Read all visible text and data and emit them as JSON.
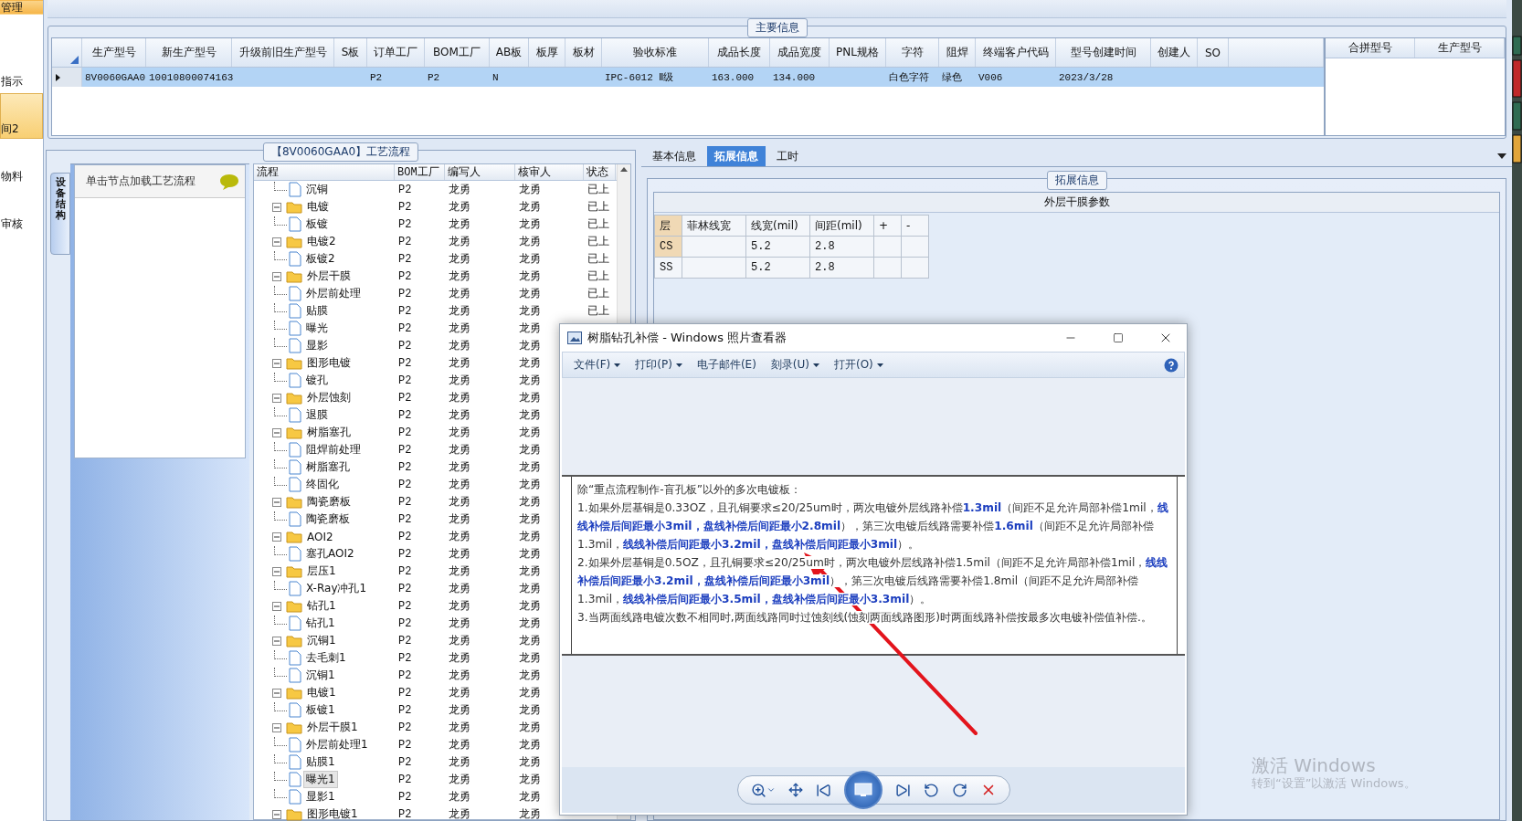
{
  "sidebar": {
    "items": [
      {
        "label": "管理",
        "kind": "header",
        "selected": false
      },
      {
        "label": "指示",
        "kind": "item",
        "selected": false
      },
      {
        "label": "间2",
        "kind": "item",
        "selected": true
      },
      {
        "label": "物料",
        "kind": "item",
        "selected": false
      },
      {
        "label": "审核",
        "kind": "item",
        "selected": false
      }
    ]
  },
  "main_info": {
    "title": "主要信息",
    "columns": [
      "生产型号",
      "新生产型号",
      "升级前旧生产型号",
      "S板",
      "订单工厂",
      "BOM工厂",
      "AB板",
      "板厚",
      "板材",
      "验收标准",
      "成品长度",
      "成品宽度",
      "PNL规格",
      "字符",
      "阻焊",
      "终端客户代码",
      "型号创建时间",
      "创建人",
      "SO"
    ],
    "rows": [
      {
        "selected": true,
        "cells": [
          "8V0060GAA0",
          "10010800074163",
          null,
          null,
          "P2",
          "P2",
          "N",
          null,
          null,
          "IPC-6012 Ⅱ级",
          "163.000",
          "134.000",
          null,
          "白色字符",
          "绿色",
          "V006",
          "2023/3/28",
          null,
          null
        ]
      }
    ],
    "side_columns": [
      "合拼型号",
      "生产型号"
    ]
  },
  "process": {
    "title": "【8V0060GAA0】工艺流程",
    "side_tab": "设备结构",
    "hint": "单击节点加载工艺流程",
    "columns": [
      "流程",
      "BOM工厂",
      "编写人",
      "核审人",
      "状态"
    ],
    "nodes": [
      {
        "children": [
          {
            "label": "沉铜",
            "bom": "P2",
            "author": "龙勇",
            "reviewer": "龙勇",
            "status": "已上",
            "selected": false
          }
        ]
      },
      {
        "label": "电镀",
        "bom": "P2",
        "author": "龙勇",
        "reviewer": "龙勇",
        "status": "已上",
        "selected": false,
        "expanded": true,
        "children": [
          {
            "label": "板镀",
            "bom": "P2",
            "author": "龙勇",
            "reviewer": "龙勇",
            "status": "已上",
            "selected": false
          }
        ]
      },
      {
        "label": "电镀2",
        "bom": "P2",
        "author": "龙勇",
        "reviewer": "龙勇",
        "status": "已上",
        "selected": false,
        "expanded": true,
        "children": [
          {
            "label": "板镀2",
            "bom": "P2",
            "author": "龙勇",
            "reviewer": "龙勇",
            "status": "已上",
            "selected": false
          }
        ]
      },
      {
        "label": "外层干膜",
        "bom": "P2",
        "author": "龙勇",
        "reviewer": "龙勇",
        "status": "已上",
        "selected": false,
        "expanded": true,
        "children": [
          {
            "label": "外层前处理",
            "bom": "P2",
            "author": "龙勇",
            "reviewer": "龙勇",
            "status": "已上",
            "selected": false
          },
          {
            "label": "贴膜",
            "bom": "P2",
            "author": "龙勇",
            "reviewer": "龙勇",
            "status": "已上",
            "selected": false
          },
          {
            "label": "曝光",
            "bom": "P2",
            "author": "龙勇",
            "reviewer": "龙勇",
            "selected": false
          },
          {
            "label": "显影",
            "bom": "P2",
            "author": "龙勇",
            "reviewer": "龙勇",
            "selected": false
          }
        ]
      },
      {
        "label": "图形电镀",
        "bom": "P2",
        "author": "龙勇",
        "reviewer": "龙勇",
        "selected": false,
        "expanded": true,
        "children": [
          {
            "label": "镀孔",
            "bom": "P2",
            "author": "龙勇",
            "reviewer": "龙勇",
            "selected": false
          }
        ]
      },
      {
        "label": "外层蚀刻",
        "bom": "P2",
        "author": "龙勇",
        "reviewer": "龙勇",
        "selected": false,
        "expanded": true,
        "children": [
          {
            "label": "退膜",
            "bom": "P2",
            "author": "龙勇",
            "reviewer": "龙勇",
            "selected": false
          }
        ]
      },
      {
        "label": "树脂塞孔",
        "bom": "P2",
        "author": "龙勇",
        "reviewer": "龙勇",
        "selected": false,
        "expanded": true,
        "children": [
          {
            "label": "阻焊前处理",
            "bom": "P2",
            "author": "龙勇",
            "reviewer": "龙勇",
            "selected": false
          },
          {
            "label": "树脂塞孔",
            "bom": "P2",
            "author": "龙勇",
            "reviewer": "龙勇",
            "selected": false
          },
          {
            "label": "终固化",
            "bom": "P2",
            "author": "龙勇",
            "reviewer": "龙勇",
            "selected": false
          }
        ]
      },
      {
        "label": "陶瓷磨板",
        "bom": "P2",
        "author": "龙勇",
        "reviewer": "龙勇",
        "selected": false,
        "expanded": true,
        "children": [
          {
            "label": "陶瓷磨板",
            "bom": "P2",
            "author": "龙勇",
            "reviewer": "龙勇",
            "selected": false
          }
        ]
      },
      {
        "label": "AOI2",
        "bom": "P2",
        "author": "龙勇",
        "reviewer": "龙勇",
        "selected": false,
        "expanded": true,
        "children": [
          {
            "label": "塞孔AOI2",
            "bom": "P2",
            "author": "龙勇",
            "reviewer": "龙勇",
            "selected": false
          }
        ]
      },
      {
        "label": "层压1",
        "bom": "P2",
        "author": "龙勇",
        "reviewer": "龙勇",
        "selected": false,
        "expanded": true,
        "children": [
          {
            "label": "X-Ray冲孔1",
            "bom": "P2",
            "author": "龙勇",
            "reviewer": "龙勇",
            "selected": false
          }
        ]
      },
      {
        "label": "钻孔1",
        "bom": "P2",
        "author": "龙勇",
        "reviewer": "龙勇",
        "selected": false,
        "expanded": true,
        "children": [
          {
            "label": "钻孔1",
            "bom": "P2",
            "author": "龙勇",
            "reviewer": "龙勇",
            "selected": false
          }
        ]
      },
      {
        "label": "沉铜1",
        "bom": "P2",
        "author": "龙勇",
        "reviewer": "龙勇",
        "selected": false,
        "expanded": true,
        "children": [
          {
            "label": "去毛刺1",
            "bom": "P2",
            "author": "龙勇",
            "reviewer": "龙勇",
            "selected": false
          },
          {
            "label": "沉铜1",
            "bom": "P2",
            "author": "龙勇",
            "reviewer": "龙勇",
            "selected": false
          }
        ]
      },
      {
        "label": "电镀1",
        "bom": "P2",
        "author": "龙勇",
        "reviewer": "龙勇",
        "selected": false,
        "expanded": true,
        "children": [
          {
            "label": "板镀1",
            "bom": "P2",
            "author": "龙勇",
            "reviewer": "龙勇",
            "selected": false
          }
        ]
      },
      {
        "label": "外层干膜1",
        "bom": "P2",
        "author": "龙勇",
        "reviewer": "龙勇",
        "selected": false,
        "expanded": true,
        "children": [
          {
            "label": "外层前处理1",
            "bom": "P2",
            "author": "龙勇",
            "reviewer": "龙勇",
            "selected": false
          },
          {
            "label": "贴膜1",
            "bom": "P2",
            "author": "龙勇",
            "reviewer": "龙勇",
            "selected": false
          },
          {
            "label": "曝光1",
            "bom": "P2",
            "author": "龙勇",
            "reviewer": "龙勇",
            "selected": true
          },
          {
            "label": "显影1",
            "bom": "P2",
            "author": "龙勇",
            "reviewer": "龙勇",
            "selected": false
          }
        ]
      },
      {
        "label": "图形电镀1",
        "bom": "P2",
        "author": "龙勇",
        "reviewer": "龙勇",
        "selected": false,
        "expanded": true
      }
    ]
  },
  "details": {
    "tabs": [
      {
        "label": "基本信息",
        "selected": false
      },
      {
        "label": "拓展信息",
        "selected": true
      },
      {
        "label": "工时",
        "selected": false
      }
    ],
    "group_title": "拓展信息",
    "section_title": "外层干膜参数",
    "columns": [
      "层",
      "菲林线宽",
      "线宽(mil)",
      "间距(mil)",
      "+",
      "-"
    ],
    "rows": [
      {
        "selected": true,
        "cells": [
          "CS",
          null,
          "5.2",
          "2.8",
          null,
          null
        ]
      },
      {
        "selected": false,
        "cells": [
          "SS",
          null,
          "5.2",
          "2.8",
          null,
          null
        ]
      }
    ]
  },
  "photo_viewer": {
    "title": "树脂钻孔补偿 - Windows 照片查看器",
    "menu": [
      {
        "label": "文件(F)",
        "dropdown": true
      },
      {
        "label": "打印(P)",
        "dropdown": true
      },
      {
        "label": "电子邮件(E)",
        "dropdown": false
      },
      {
        "label": "刻录(U)",
        "dropdown": true
      },
      {
        "label": "打开(O)",
        "dropdown": true
      }
    ],
    "document": [
      "除“重点流程制作-盲孔板”以外的多次电镀板：",
      "1.如果外层基铜是0.33OZ，且孔铜要求≤20/25um时，两次电镀外层线路补偿**1.3mil**（间距不足允许局部补偿1mil，**线线补偿后间距最小3mil，盘线补偿后间距最小2.8mil**），第三次电镀后线路需要补偿**1.6mil**（间距不足允许局部补偿1.3mil，**线线补偿后间距最小3.2mil，盘线补偿后间距最小3mil**）。",
      "2.如果外层基铜是0.5OZ，且孔铜要求≤20/25um时，两次电镀外层线路补偿1.5mil（间距不足允许局部补偿1mil，**线线补偿后间距最小3.2mil，盘线补偿后间距最小3mil**），第三次电镀后线路需要补偿1.8mil（间距不足允许局部补偿1.3mil，**线线补偿后间距最小3.5mil，盘线补偿后间距最小3.3mil**）。",
      "3.当两面线路电镀次数不相同时,两面线路同时过蚀刻线(蚀刻两面线路图形)时两面线路补偿按最多次电镀补偿值补偿.。"
    ]
  },
  "watermark": {
    "title": "激活 Windows",
    "subtitle": "转到“设置”以激活 Windows。"
  }
}
